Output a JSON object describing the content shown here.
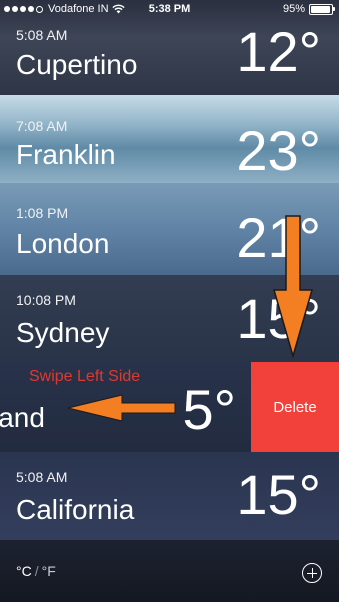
{
  "status_bar": {
    "carrier": "Vodafone IN",
    "time": "5:38 PM",
    "battery": "95%",
    "signal_filled": 4,
    "signal_total": 5,
    "battery_fraction": 0.95
  },
  "cities": [
    {
      "time": "5:08 AM",
      "name": "Cupertino",
      "temp": "12°"
    },
    {
      "time": "7:08 AM",
      "name": "Franklin",
      "temp": "23°"
    },
    {
      "time": "1:08 PM",
      "name": "London",
      "temp": "21°"
    },
    {
      "time": "10:08 PM",
      "name": "Sydney",
      "temp": "15°"
    },
    {
      "time": "",
      "name": "land",
      "temp": "5°"
    },
    {
      "time": "5:08 AM",
      "name": "California",
      "temp": "15°"
    }
  ],
  "delete_label": "Delete",
  "annotation": "Swipe Left Side",
  "footer": {
    "celsius": "°C",
    "separator": "/",
    "fahrenheit": "°F"
  },
  "colors": {
    "delete": "#f2413a",
    "arrow": "#f47e22",
    "annotation": "#e0392f"
  },
  "icons": {
    "wifi": "wifi-icon",
    "add": "add-icon",
    "arrow_down": "arrow-down-icon",
    "arrow_left": "arrow-left-icon"
  }
}
